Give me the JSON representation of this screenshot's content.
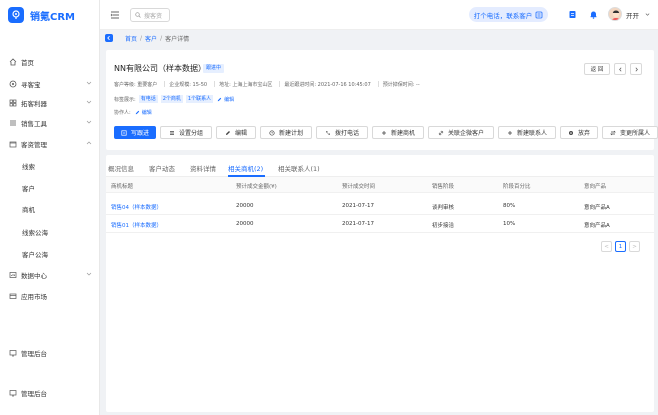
{
  "app": {
    "name": "销氪CRM"
  },
  "sidebar": {
    "items": [
      {
        "label": "首页",
        "icon": "home-icon"
      },
      {
        "label": "寻客宝",
        "icon": "compass-icon"
      },
      {
        "label": "拓客利器",
        "icon": "grid-icon"
      },
      {
        "label": "销售工具",
        "icon": "tools-icon"
      },
      {
        "label": "客资管理",
        "icon": "customer-folder-icon"
      },
      {
        "label": "线索"
      },
      {
        "label": "客户"
      },
      {
        "label": "商机"
      },
      {
        "label": "线索公海"
      },
      {
        "label": "客户公海"
      },
      {
        "label": "数据中心",
        "icon": "data-icon"
      },
      {
        "label": "应用市场",
        "icon": "market-icon"
      },
      {
        "label": "管理后台",
        "icon": "admin-icon"
      },
      {
        "label": "管理后台",
        "icon": "admin-icon"
      }
    ]
  },
  "header": {
    "search_placeholder": "搜客资",
    "call_label": "打个电话，联系客户",
    "user_name": "开开"
  },
  "breadcrumb": {
    "home": "首页",
    "customer": "客户",
    "current": "客户详情"
  },
  "detail": {
    "company": "NN有限公司（样本数据）",
    "status": "跟进中",
    "return_label": "返 回",
    "meta": {
      "level": "客户等级: 重要客户",
      "scale": "企业规模: 15-50",
      "address": "地址: 上海上海市宝山区",
      "last_follow": "最近跟进时间: 2021-07-16 10:45:07",
      "expected_release": "预计掉保时间: --"
    },
    "tags_label": "标签展示:",
    "tags": [
      "有电话",
      "2个商机",
      "1个联系人"
    ],
    "edit_label": "编辑",
    "collab_label": "协作人:",
    "actions": [
      "写跟进",
      "设置分组",
      "编辑",
      "新建计划",
      "拨打电话",
      "新建商机",
      "关联企微客户",
      "新建联系人",
      "放弃",
      "变更所属人"
    ]
  },
  "tabs": [
    "概况信息",
    "客户动态",
    "资料详情",
    "相关商机(2)",
    "相关联系人(1)"
  ],
  "table": {
    "columns": [
      "商机标题",
      "预计成交金额(¥)",
      "预计成交时间",
      "销售阶段",
      "阶段百分比",
      "意向产品"
    ],
    "rows": [
      [
        "销售04（样本数据）",
        "20000",
        "2021-07-17",
        "谈判审核",
        "80%",
        "意向产品A"
      ],
      [
        "销售01（样本数据）",
        "20000",
        "2021-07-17",
        "初步接洽",
        "10%",
        "意向产品A"
      ]
    ]
  },
  "pager": {
    "prev": "<",
    "page": "1",
    "next": ">"
  },
  "colors": {
    "accent": "#1a6dff",
    "tag_bg": "#e6efff"
  }
}
